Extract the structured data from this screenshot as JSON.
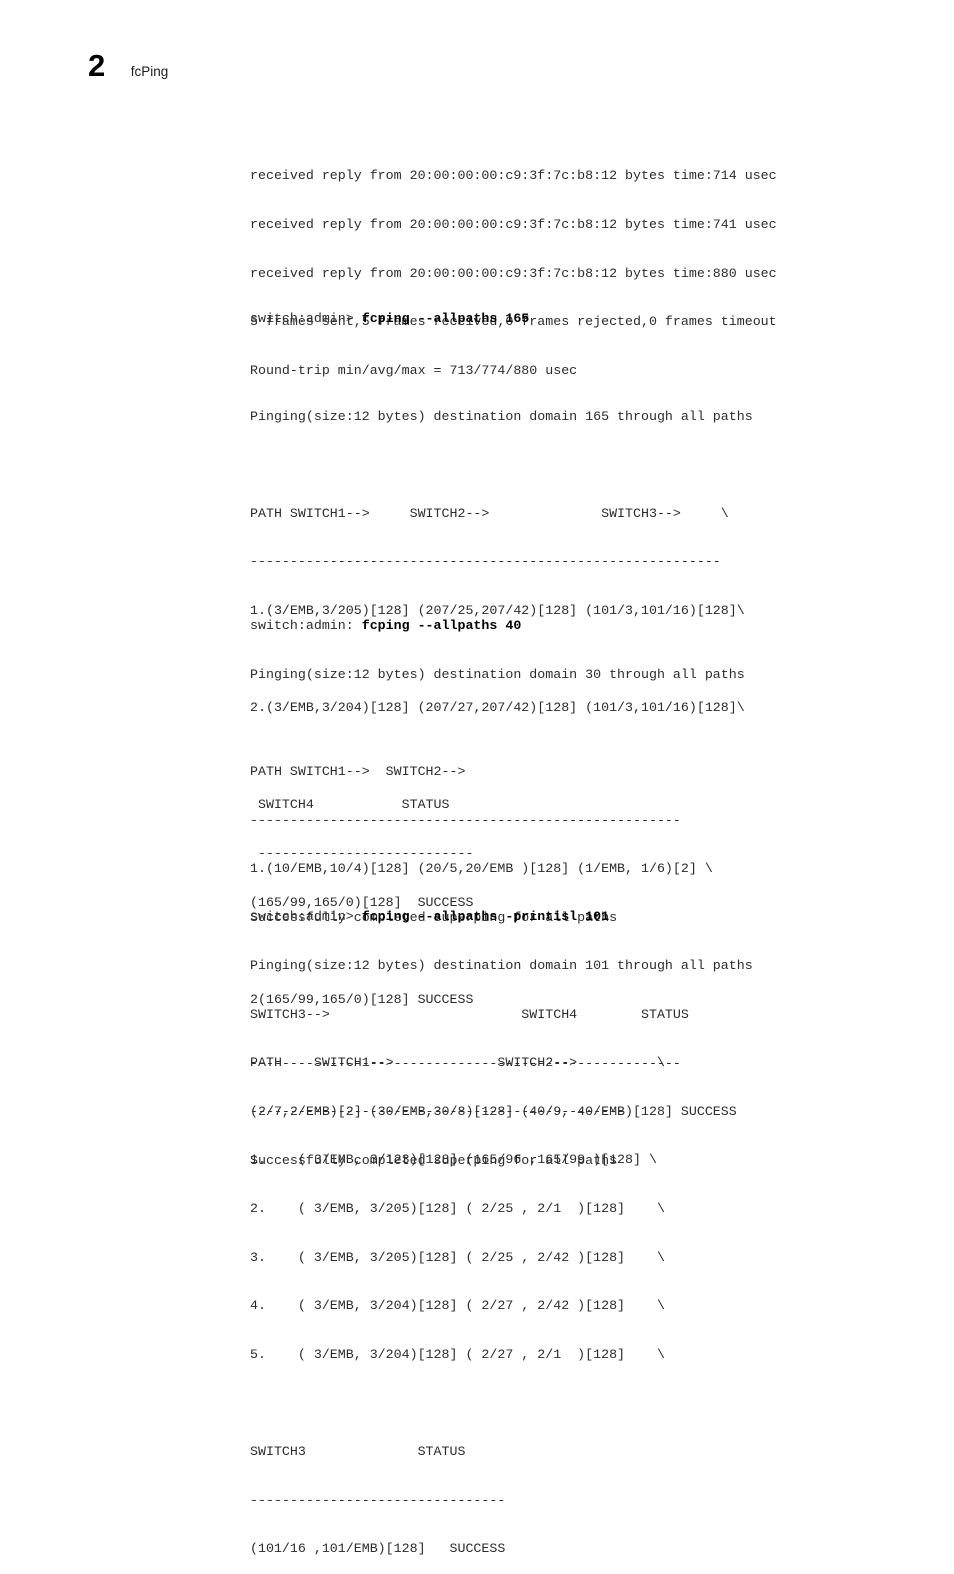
{
  "header": {
    "chapter_number": "2",
    "chapter_title": "fcPing"
  },
  "blocks": {
    "ping_summary": {
      "lines": [
        "received reply from 20:00:00:00:c9:3f:7c:b8:12 bytes time:714 usec",
        "received reply from 20:00:00:00:c9:3f:7c:b8:12 bytes time:741 usec",
        "received reply from 20:00:00:00:c9:3f:7c:b8:12 bytes time:880 usec",
        "5 frames sent,5 frames received,0 frames rejected,0 frames timeout",
        "Round-trip min/avg/max = 713/774/880 usec"
      ]
    },
    "allpaths_165": {
      "prompt": "switch:admin> ",
      "command": "fcping --allpaths 165",
      "lines": [
        "",
        "Pinging(size:12 bytes) destination domain 165 through all paths",
        "",
        "PATH SWITCH1-->     SWITCH2-->              SWITCH3-->     \\",
        "-----------------------------------------------------------",
        "1.(3/EMB,3/205)[128] (207/25,207/42)[128] (101/3,101/16)[128]\\",
        "",
        "2.(3/EMB,3/204)[128] (207/27,207/42)[128] (101/3,101/16)[128]\\",
        "",
        " SWITCH4           STATUS",
        " ---------------------------",
        "(165/99,165/0)[128]  SUCCESS",
        "",
        "2(165/99,165/0)[128] SUCCESS"
      ]
    },
    "allpaths_40": {
      "prompt": "switch:admin: ",
      "command": "fcping --allpaths 40",
      "lines": [
        "Pinging(size:12 bytes) destination domain 30 through all paths",
        "",
        "PATH SWITCH1-->  SWITCH2-->",
        "------------------------------------------------------",
        "1.(10/EMB,10/4)[128] (20/5,20/EMB )[128] (1/EMB, 1/6)[2] \\",
        "Successfully completed superping for all paths",
        "",
        "SWITCH3-->                        SWITCH4        STATUS",
        "------------------------------------------------------",
        "(2/7,2/EMB)[2] (30/EMB,30/8)[128] (40/9, 40/EMB)[128] SUCCESS",
        "Successfully completed superping for all paths"
      ]
    },
    "allpaths_printisl": {
      "prompt": "switch:admin> ",
      "command": "fcping --allpaths -printisl 101",
      "lines": [
        "Pinging(size:12 bytes) destination domain 101 through all paths",
        "",
        "PATH    SWITCH1-->             SWITCH2-->          \\",
        "-----------------------------------------------",
        "1.    ( 3/EMB, 3/123)[128] (165/96 ,165/99 )[128] \\",
        "2.    ( 3/EMB, 3/205)[128] ( 2/25 , 2/1  )[128]    \\",
        "3.    ( 3/EMB, 3/205)[128] ( 2/25 , 2/42 )[128]    \\",
        "4.    ( 3/EMB, 3/204)[128] ( 2/27 , 2/42 )[128]    \\",
        "5.    ( 3/EMB, 3/204)[128] ( 2/27 , 2/1  )[128]    \\",
        "",
        "SWITCH3              STATUS",
        "--------------------------------",
        "(101/16 ,101/EMB)[128]   SUCCESS"
      ]
    }
  }
}
